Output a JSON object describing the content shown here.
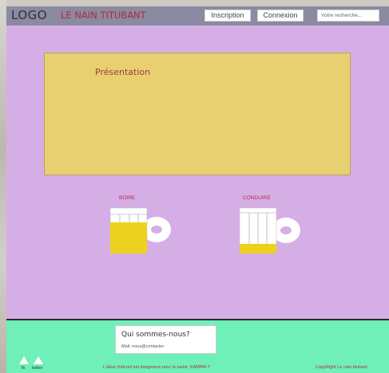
{
  "header": {
    "logo": "LOGO",
    "site_title": "LE NAIN TITUBANT",
    "inscription_label": "Inscription",
    "connexion_label": "Connexion",
    "search_placeholder": "Votre recherche..."
  },
  "main": {
    "presentation_title": "Présentation",
    "mugs": [
      {
        "label": "BOIRE",
        "fill_level": 0.7
      },
      {
        "label": "CONDUIRE",
        "fill_level": 0.2
      }
    ]
  },
  "footer": {
    "about_title": "Qui sommes-nous?",
    "about_mail": "Mail: nous@contacter",
    "social": [
      {
        "label": "fb",
        "icon": "triangle-icon"
      },
      {
        "label": "twitter",
        "icon": "triangle-icon"
      }
    ],
    "warning": "L'abus d'alcool est dangereux pour la santé, KAMPAI !!",
    "copyright": "CopyRight Le nain titubant"
  },
  "colors": {
    "page_bg": "#d6aee6",
    "header_bg": "#8a8aa0",
    "presentation_bg": "#e8d070",
    "footer_bg": "#6ef0b8",
    "accent_red": "#b22a3a",
    "beer_yellow": "#ecd21e"
  }
}
